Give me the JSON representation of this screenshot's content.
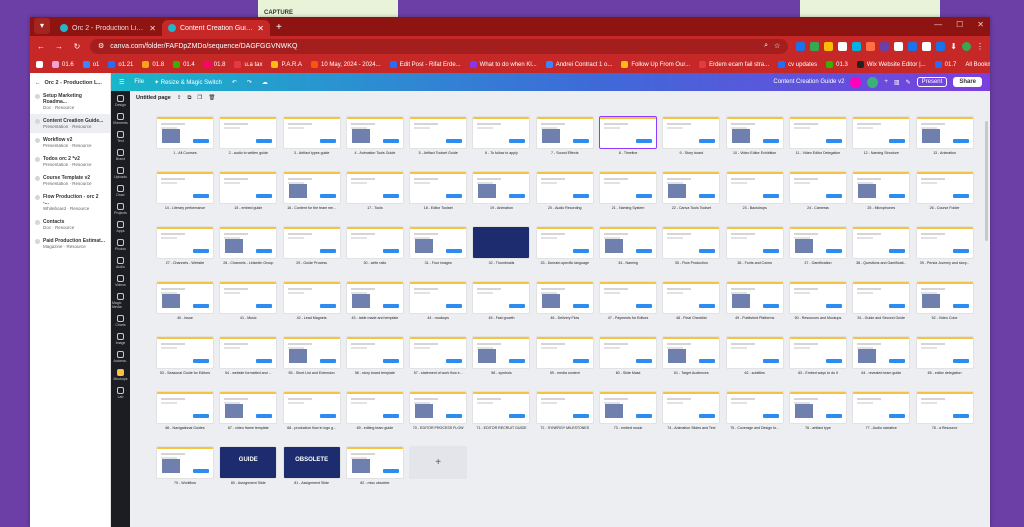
{
  "background": {
    "color": "#6b3fa6",
    "card_left_text": "CAPTURE",
    "card_right_text": ""
  },
  "tabs": [
    {
      "label": "Orc 2 - Production Line Environment",
      "active": false
    },
    {
      "label": "Content Creation Guide v2 | Orc 2",
      "active": true
    }
  ],
  "address": {
    "url": "canva.com/folder/FAFDpZMDo/sequence/DAGFGGVNWKQ"
  },
  "bookmarks": [
    {
      "label": "01.6",
      "color": "#f3a1d4"
    },
    {
      "label": "o1",
      "color": "#3a86ff"
    },
    {
      "label": "o1.21",
      "color": "#2b6cf5"
    },
    {
      "label": "01.8",
      "color": "#f7a21b"
    },
    {
      "label": "01.4",
      "color": "#38b000"
    },
    {
      "label": "01.8",
      "color": "#ff006e"
    },
    {
      "label": "u.a tax",
      "color": "#e63946"
    },
    {
      "label": "P.A.R.A",
      "color": "#ffbe0b"
    },
    {
      "label": "10 May, 2024 - 2024...",
      "color": "#fb5607"
    },
    {
      "label": "Edit Post - Rifat Erde...",
      "color": "#2b6cf5"
    },
    {
      "label": "What to do when Kl...",
      "color": "#8338ec"
    },
    {
      "label": "Andrei Contract 1 o...",
      "color": "#3a86ff"
    },
    {
      "label": "Follow Up From Our...",
      "color": "#ffbe0b"
    },
    {
      "label": "Erdem ecam fail stra...",
      "color": "#e63946"
    },
    {
      "label": "cv updates",
      "color": "#2b6cf5"
    },
    {
      "label": "01.3",
      "color": "#38b000"
    },
    {
      "label": "Wix Website Editor |...",
      "color": "#222222"
    },
    {
      "label": "01.7",
      "color": "#2b6cf5"
    }
  ],
  "bookmarks_all": "All Bookmarks",
  "left_panel": {
    "back": "Orc 2 - Production L...",
    "items": [
      {
        "title": "Setup Marketing Roadma...",
        "sub": "Doc · Resource",
        "selected": false
      },
      {
        "title": "Content Creation Guide...",
        "sub": "Presentation · Resource",
        "selected": true
      },
      {
        "title": "Workflow v2",
        "sub": "Presentation · Resource",
        "selected": false
      },
      {
        "title": "Todos orc 2 *v2",
        "sub": "Presentation · Resource",
        "selected": false
      },
      {
        "title": "Course Template v2",
        "sub": "Presentation · Resource",
        "selected": false
      },
      {
        "title": "Flow Production - orc 2 -...",
        "sub": "Whiteboard · Resource",
        "selected": false
      },
      {
        "title": "Contacts",
        "sub": "Doc · Resource",
        "selected": false
      },
      {
        "title": "Paid Production Estimat...",
        "sub": "Magazine · Resource",
        "selected": false
      }
    ]
  },
  "canva_bar": {
    "file": "File",
    "resize": "✦ Resize & Magic Switch",
    "doc_title": "Content Creation Guide v2",
    "present": "Present",
    "share": "Share"
  },
  "rail": [
    "Design",
    "Elements",
    "Text",
    "Brand",
    "Uploads",
    "Draw",
    "Projects",
    "Apps",
    "Photos",
    "Audio",
    "Videos",
    "Magic Media",
    "Charts",
    "Image",
    "Automa..",
    "Mockups",
    "Lab"
  ],
  "workspace": {
    "heading": "Untitled page"
  },
  "pages": [
    "1 - All Courses",
    "2 - audio to written guide",
    "3 - Artifact types guide",
    "4 - Animation Tools Guide",
    "5 - Artifact Toolset Guide",
    "6 - To follow to apply",
    "7 - Sound Effects",
    "8 - Timeline",
    "9 - Story board",
    "10 - Video Editor Exhibition",
    "11 - Video Editor Delegation",
    "12 - Naming Structure",
    "13 - Animation",
    "14 - Literary performance",
    "15 - embed guide",
    "16 - Content for the team me...",
    "17 - Tools",
    "18 - Editor Toolset",
    "19 - Animation",
    "20 - Audio Recording",
    "21 - Naming System",
    "22 - Canva Tools Toolset",
    "23 - Backdrops",
    "24 - Cameras",
    "25 - Microphones",
    "26 - Course Folder",
    "27 - Channels - Website",
    "28 - Channels - LinkedIn Group",
    "29 - Guide Process",
    "30 - write ratio",
    "31 - Four images",
    "32 - Thumbnails",
    "33 - Domain-specific language",
    "34 - Naming",
    "35 - Flow Production",
    "36 - Fonts and Colors",
    "37 - Gamification",
    "38 - Questions and Gamificati...",
    "39 - Persia Journey and story...",
    "40 - Issue",
    "41 - Music",
    "42 - Lead Magnets",
    "43 - table made and template",
    "44 - mockups",
    "45 - Fast growth",
    "46 - Delivery Flow",
    "47 - Payments for Editors",
    "48 - Final Checklist",
    "49 - Published Platforms",
    "50 - Resources and Mockups",
    "51 - Guide and Second Guide",
    "52 - Video Color",
    "53 - Seasonal Guide for Editors",
    "54 - website formatted and ...",
    "55 - Short List and Extension",
    "56 - story board template",
    "57 - statement of work flow e...",
    "58 - symbols",
    "59 - media content",
    "60 - Slide Mask",
    "61 - Target Audiences",
    "62 - subtitles",
    "63 - Embed ways to do it",
    "64 - revealed team guide",
    "65 - editor delegation",
    "66 - Navigational Guides",
    "67 - video frame template",
    "68 - production flow in ings g...",
    "69 - editing team guide",
    "70 - EDITOR PROCESS FLOW",
    "71 - EDITOR RECRUIT GUIDE",
    "72 - SYNERGY MILESTONES",
    "73 - embed music",
    "74 - Animation Slides and Text",
    "75 - Coverage and Design fo...",
    "76 - artifact type",
    "77 - Audio narrative",
    "78 - a Resource",
    "79 - Workflow",
    "80 - Assignment Slide",
    "81 - Assignment Slide",
    "82 - misc obsolete"
  ],
  "dark_pages": {
    "32": "",
    "80": "GUIDE",
    "81": "OBSOLETE"
  },
  "selected_page": 8
}
